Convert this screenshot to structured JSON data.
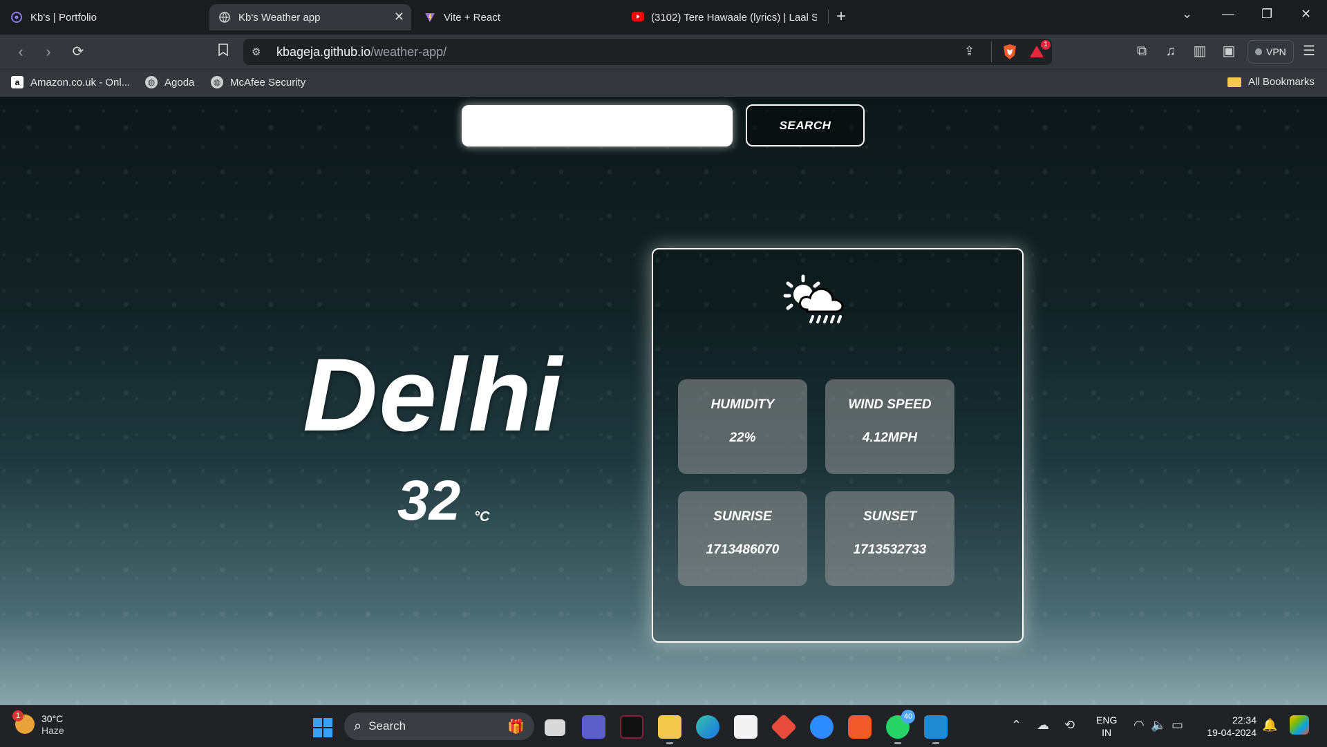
{
  "browser": {
    "tabs": [
      {
        "title": "Kb's | Portfolio",
        "active": false
      },
      {
        "title": "Kb's Weather app",
        "active": true
      },
      {
        "title": "Vite + React",
        "active": false
      },
      {
        "title": "(3102) Tere Hawaale (lyrics) | Laal Sin",
        "active": false
      }
    ],
    "url_host": "kbageja.github.io",
    "url_path": "/weather-app/",
    "notification_count": "1",
    "vpn_label": "VPN",
    "bookmarks": [
      "Amazon.co.uk - Onl...",
      "Agoda",
      "McAfee Security"
    ],
    "all_bookmarks_label": "All Bookmarks"
  },
  "app": {
    "search": {
      "placeholder": "",
      "value": "",
      "button_label": "SEARCH"
    },
    "city": "Delhi",
    "temperature": "32",
    "unit": "°C",
    "weather_icon": "partly-sunny-rain-icon",
    "stats": [
      {
        "label": "HUMIDITY",
        "value": "22%"
      },
      {
        "label": "WIND SPEED",
        "value": "4.12MPH"
      },
      {
        "label": "SUNRISE",
        "value": "1713486070"
      },
      {
        "label": "SUNSET",
        "value": "1713532733"
      }
    ]
  },
  "taskbar": {
    "weather_temp": "30°C",
    "weather_desc": "Haze",
    "weather_badge": "1",
    "search_label": "Search",
    "whatsapp_badge": "40",
    "lang_line1": "ENG",
    "lang_line2": "IN",
    "time": "22:34",
    "date": "19-04-2024"
  },
  "colors": {
    "accent_blue": "#4ea6ff",
    "stat_card": "#969696",
    "brave_orange": "#f25a29"
  }
}
